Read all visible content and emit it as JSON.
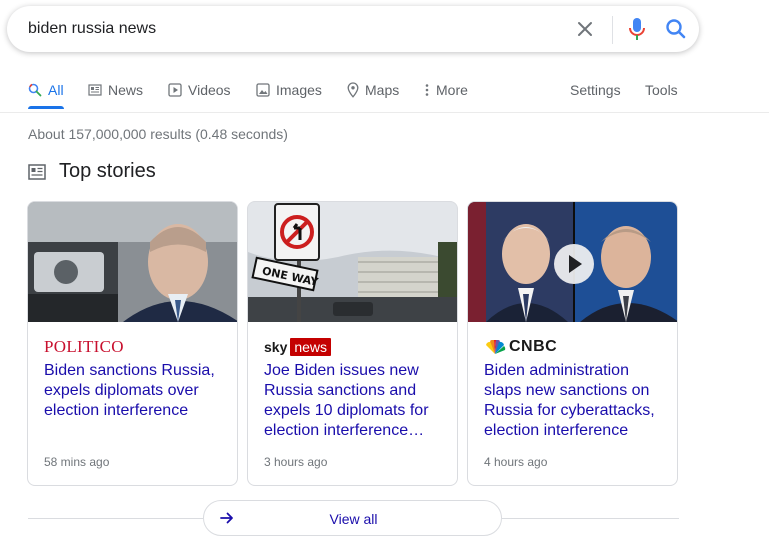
{
  "search": {
    "query": "biden russia news"
  },
  "icons": {
    "clear": "close-icon",
    "mic": "microphone-icon",
    "search": "search-icon"
  },
  "tabs": [
    {
      "label": "All",
      "icon": "search-icon",
      "active": true
    },
    {
      "label": "News",
      "icon": "newspaper-icon"
    },
    {
      "label": "Videos",
      "icon": "play-icon"
    },
    {
      "label": "Images",
      "icon": "image-icon"
    },
    {
      "label": "Maps",
      "icon": "map-pin-icon"
    },
    {
      "label": "More",
      "icon": "kebab-icon"
    }
  ],
  "tools": {
    "settings": "Settings",
    "tools": "Tools"
  },
  "result_stats": "About 157,000,000 results (0.48 seconds)",
  "top_stories": {
    "title": "Top stories",
    "cards": [
      {
        "publisher": "POLITICO",
        "headline": "Biden sanctions Russia, expels diplomats over election interference",
        "age": "58 mins ago"
      },
      {
        "publisher_a": "sky",
        "publisher_b": "news",
        "headline": "Joe Biden issues new Russia sanctions and expels 10 diplomats for election interference and…",
        "age": "3 hours ago"
      },
      {
        "publisher": "CNBC",
        "headline": "Biden administration slaps new sanctions on Russia for cyberattacks, election interference",
        "age": "4 hours ago"
      }
    ],
    "view_all": "View all"
  },
  "sign_text": "ONE WAY",
  "colors": {
    "accent_blue": "#1a73e8",
    "link": "#1a0dab",
    "politico_red": "#c8102e",
    "sky_red": "#c40000"
  }
}
